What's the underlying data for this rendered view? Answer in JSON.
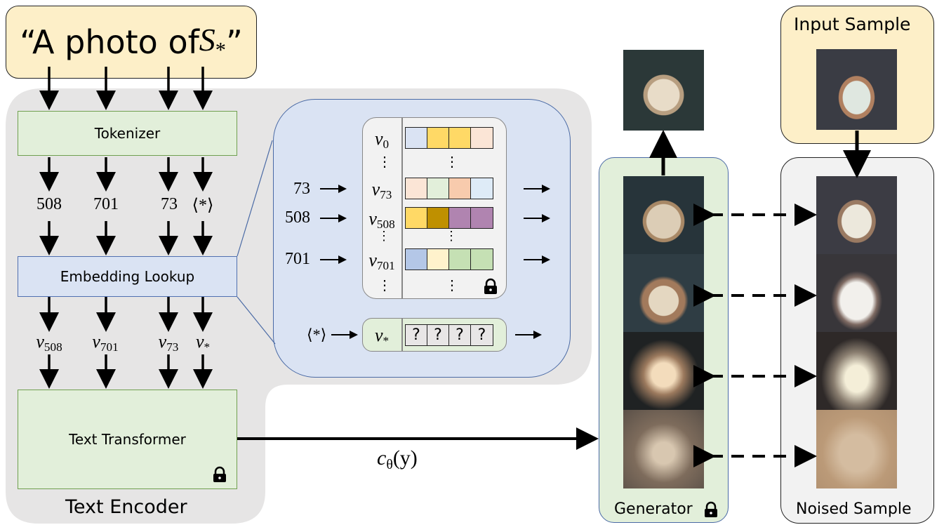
{
  "prompt": {
    "text_prefix": "“A photo of ",
    "symbol": "S",
    "symbol_sub": "*",
    "text_suffix": "”"
  },
  "encoder": {
    "title": "Text Encoder",
    "tokenizer_label": "Tokenizer",
    "embedding_label": "Embedding Lookup",
    "transformer_label": "Text Transformer",
    "tokens": [
      "508",
      "701",
      "73",
      "⟨*⟩"
    ],
    "vectors": [
      {
        "base": "v",
        "sub": "508"
      },
      {
        "base": "v",
        "sub": "701"
      },
      {
        "base": "v",
        "sub": "73"
      },
      {
        "base": "v",
        "sub": "*"
      }
    ],
    "transformer_frozen_icon": "lock-icon"
  },
  "embedding_table": {
    "rows": [
      {
        "input": "",
        "base": "v",
        "sub": "0",
        "colors": [
          "#dae3f3",
          "#ffd966",
          "#ffd966",
          "#fbe5d6"
        ]
      },
      {
        "input": "73",
        "base": "v",
        "sub": "73",
        "colors": [
          "#fbe5d6",
          "#e2efda",
          "#f8cbad",
          "#deebf7"
        ]
      },
      {
        "input": "508",
        "base": "v",
        "sub": "508",
        "colors": [
          "#ffd966",
          "#bf9000",
          "#b084b0",
          "#b084b0"
        ]
      },
      {
        "input": "701",
        "base": "v",
        "sub": "701",
        "colors": [
          "#b4c7e7",
          "#fff2cc",
          "#c5e0b4",
          "#c5e0b4"
        ]
      }
    ],
    "ellipsis": "⋮",
    "frozen_icon": "lock-icon",
    "new_token": {
      "input": "⟨*⟩",
      "base": "v",
      "sub": "*",
      "cells": [
        "?",
        "?",
        "?",
        "?"
      ]
    }
  },
  "conditioning": {
    "base": "c",
    "sub": "θ",
    "arg": "(y)"
  },
  "generator": {
    "label": "Generator",
    "frozen_icon": "lock-icon",
    "steps": 4
  },
  "noised": {
    "label": "Noised Sample",
    "steps": 4
  },
  "input_sample": {
    "label": "Input Sample"
  },
  "colors": {
    "cream": "#fdefc8",
    "green": "#e2efda",
    "blue": "#dae3f3",
    "gray": "#e6e5e5",
    "panel_gray": "#f2f2f2"
  }
}
